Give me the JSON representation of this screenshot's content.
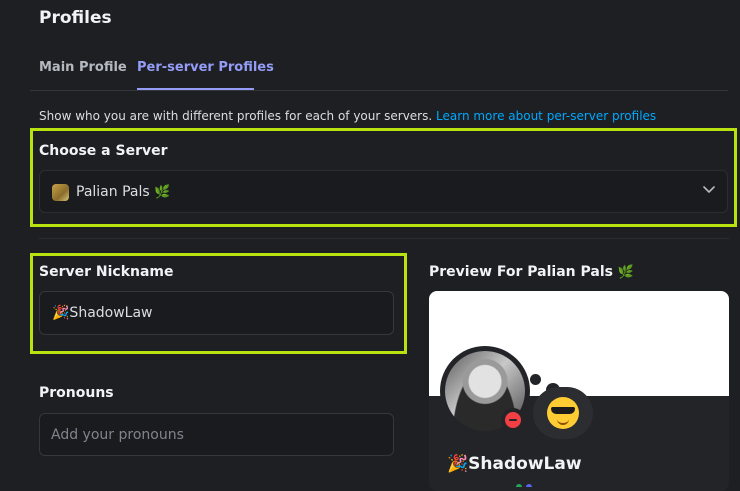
{
  "page": {
    "title": "Profiles"
  },
  "tabs": [
    {
      "label": "Main Profile",
      "active": false
    },
    {
      "label": "Per-server Profiles",
      "active": true
    }
  ],
  "description": {
    "text": "Show who you are with different profiles for each of your servers.",
    "link": "Learn more about per-server profiles"
  },
  "server_chooser": {
    "label": "Choose a Server",
    "selected_server": "Palian Pals",
    "server_emoji": "🌿",
    "icon": "chevron-down-icon"
  },
  "nickname": {
    "label": "Server Nickname",
    "value": "🎉ShadowLaw"
  },
  "pronouns": {
    "label": "Pronouns",
    "placeholder": "Add your pronouns"
  },
  "preview": {
    "label": "Preview For Palian Pals",
    "label_emoji": "🌿",
    "display_name": "🎉ShadowLaw",
    "status": "do-not-disturb",
    "status_emoji": "😎"
  },
  "colors": {
    "accent": "#949cf7",
    "link": "#00a8fc",
    "highlight": "#b9e30e",
    "status_dnd": "#f23f43"
  }
}
